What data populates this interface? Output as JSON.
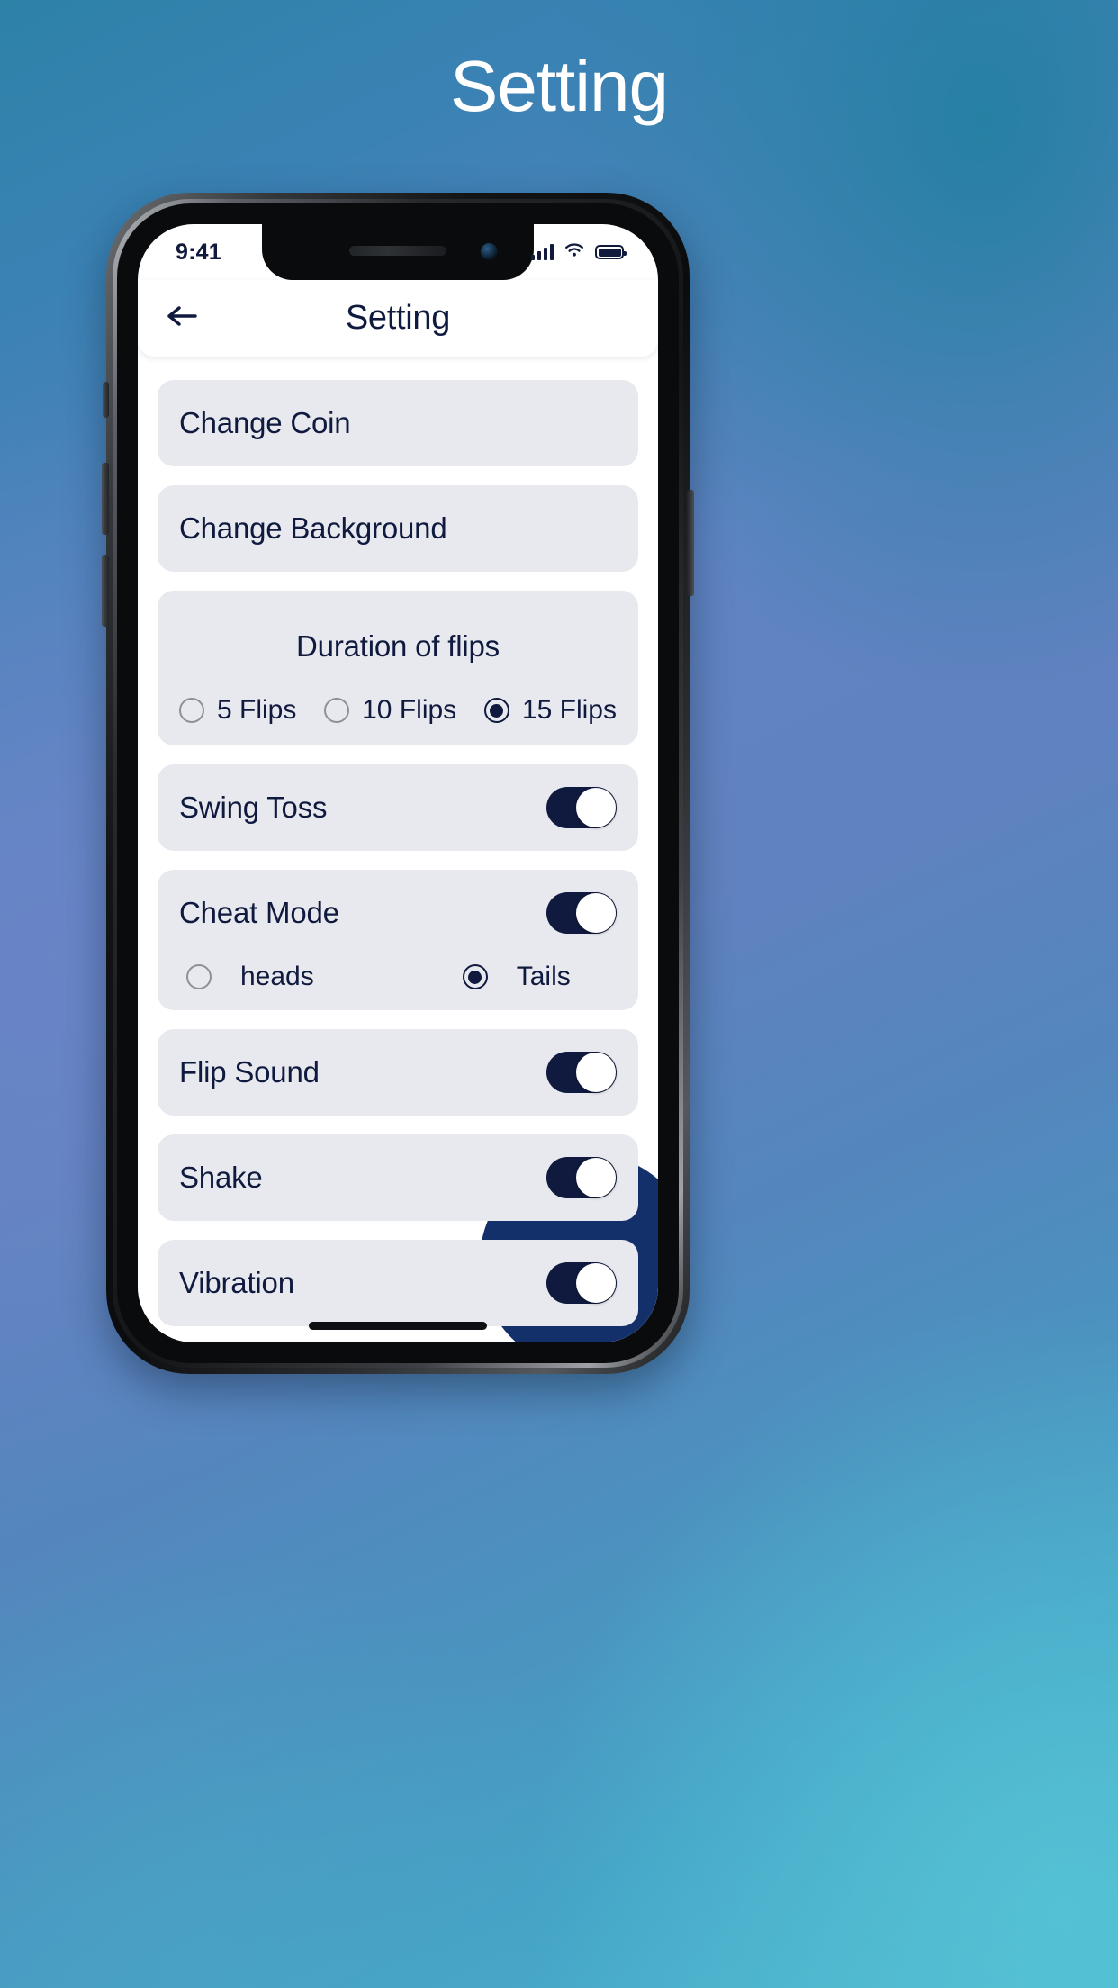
{
  "page": {
    "title": "Setting",
    "background_colors": [
      "#2d82a8",
      "#6182c0",
      "#4fb6ce"
    ]
  },
  "phone": {
    "status_bar": {
      "time": "9:41",
      "signal_icon": "cellular-signal-icon",
      "wifi_icon": "wifi-icon",
      "battery_icon": "battery-full-icon"
    },
    "app_bar": {
      "back_icon": "back-arrow-icon",
      "title": "Setting"
    },
    "accent_color": "#101a3e",
    "card_color": "#e7e9ee"
  },
  "settings": {
    "items": [
      {
        "type": "link",
        "label": "Change Coin"
      },
      {
        "type": "link",
        "label": "Change Background"
      }
    ],
    "duration": {
      "title": "Duration of flips",
      "options": [
        {
          "label": "5 Flips",
          "selected": false
        },
        {
          "label": "10 Flips",
          "selected": false
        },
        {
          "label": "15 Flips",
          "selected": true
        }
      ]
    },
    "swing_toss": {
      "label": "Swing Toss",
      "on": true
    },
    "cheat_mode": {
      "label": "Cheat Mode",
      "on": true,
      "options": [
        {
          "label": "heads",
          "selected": false
        },
        {
          "label": "Tails",
          "selected": true
        }
      ]
    },
    "flip_sound": {
      "label": "Flip Sound",
      "on": true
    },
    "shake": {
      "label": "Shake",
      "on": true
    },
    "vibration": {
      "label": "Vibration",
      "on": true
    }
  }
}
